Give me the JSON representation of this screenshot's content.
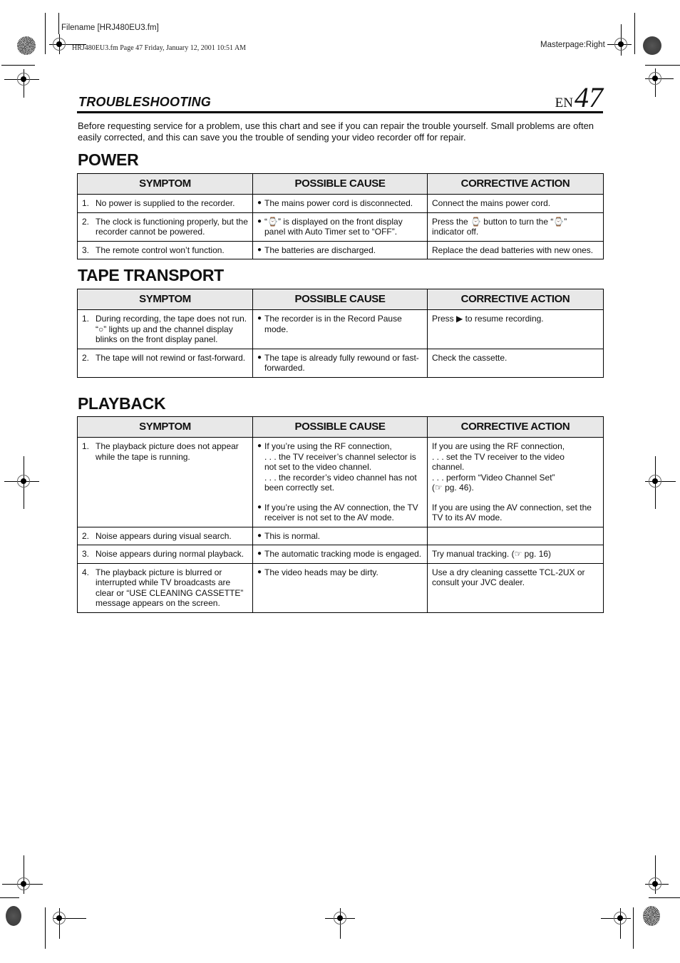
{
  "print_meta": {
    "filename": "Filename [HRJ480EU3.fm]",
    "page_stamp": "HRJ480EU3.fm  Page 47  Friday, January 12, 2001  10:51 AM",
    "masterpage": "Masterpage:Right"
  },
  "header": {
    "title": "TROUBLESHOOTING",
    "lang": "EN",
    "page_number": "47"
  },
  "intro": "Before requesting service for a problem, use this chart and see if you can repair the trouble yourself. Small problems are often easily corrected, and this can save you the trouble of sending your video recorder off for repair.",
  "columns": [
    "SYMPTOM",
    "POSSIBLE CAUSE",
    "CORRECTIVE ACTION"
  ],
  "sections": [
    {
      "title": "POWER",
      "rows": [
        {
          "num": "1.",
          "symptom": "No power is supplied to the recorder.",
          "causes": [
            "The mains power cord is disconnected."
          ],
          "actions": [
            "Connect the mains power cord."
          ]
        },
        {
          "num": "2.",
          "symptom": "The clock is functioning properly, but the recorder cannot be powered.",
          "causes": [
            "“⌚” is displayed on the front display panel with Auto Timer set to “OFF”."
          ],
          "actions": [
            "Press the ⌚ button to turn the “⌚” indicator off."
          ]
        },
        {
          "num": "3.",
          "symptom": "The remote control won’t function.",
          "causes": [
            "The batteries are discharged."
          ],
          "actions": [
            "Replace the dead batteries with new ones."
          ]
        }
      ]
    },
    {
      "title": "TAPE TRANSPORT",
      "rows": [
        {
          "num": "1.",
          "symptom": "During recording, the tape does not run. “○” lights up and the channel display blinks on the front display panel.",
          "causes": [
            "The recorder is in the Record Pause mode."
          ],
          "actions": [
            "Press ▶ to resume recording."
          ]
        },
        {
          "num": "2.",
          "symptom": "The tape will not rewind or fast-forward.",
          "causes": [
            "The tape is already fully rewound or fast-forwarded."
          ],
          "actions": [
            "Check the cassette."
          ]
        }
      ]
    },
    {
      "title": "PLAYBACK",
      "rows": [
        {
          "num": "1.",
          "symptom": "The playback picture does not appear while the tape is running.",
          "causes": [
            "If you’re using the RF connection,\n. . . the TV receiver’s channel selector is not set to the video channel.\n. . . the recorder’s video channel has not been correctly set.",
            "If you’re using the AV connection, the TV receiver is not set to the AV mode."
          ],
          "actions": [
            "If you are using the RF connection,\n. . . set the TV receiver to the video channel.\n. . . perform “Video Channel Set”\n(☞ pg. 46).",
            "If you are using the AV connection, set the TV to its AV mode."
          ]
        },
        {
          "num": "2.",
          "symptom": "Noise appears during visual search.",
          "causes": [
            "This is normal."
          ],
          "actions": []
        },
        {
          "num": "3.",
          "symptom": "Noise appears during normal playback.",
          "causes": [
            "The automatic tracking mode is engaged."
          ],
          "actions": [
            "Try manual tracking. (☞ pg. 16)"
          ]
        },
        {
          "num": "4.",
          "symptom": "The playback picture is blurred or interrupted while TV broadcasts are clear or “USE CLEANING CASSETTE” message appears on the screen.",
          "causes": [
            "The video heads may be dirty."
          ],
          "actions": [
            "Use a dry cleaning cassette TCL-2UX or consult your JVC dealer."
          ]
        }
      ]
    }
  ]
}
